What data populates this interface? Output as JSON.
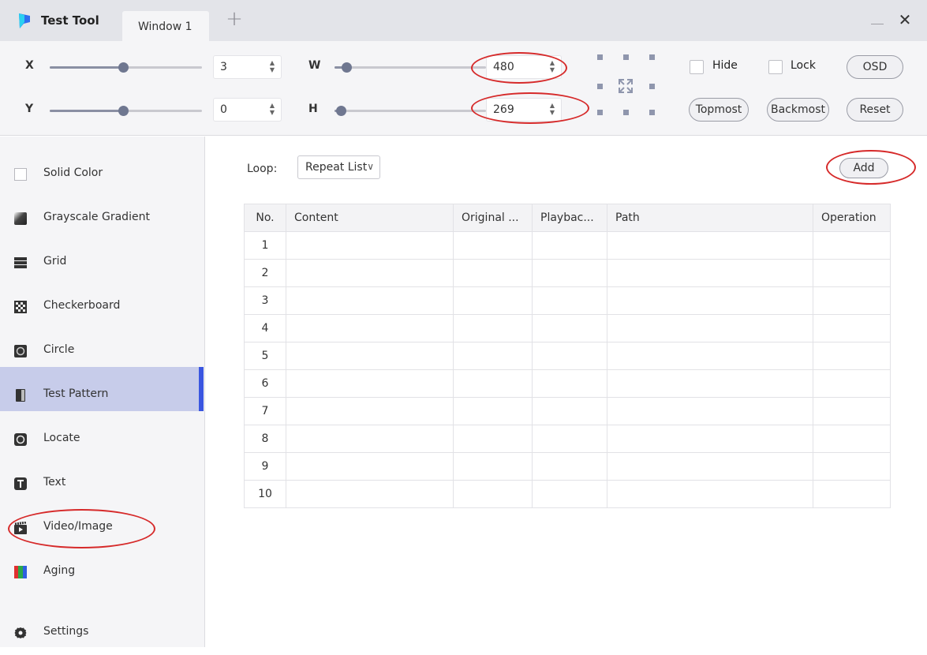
{
  "app": {
    "title": "Test Tool"
  },
  "tabs": [
    {
      "label": "Window 1"
    }
  ],
  "window_controls": {
    "minimize": "—",
    "close": "✕"
  },
  "toolbar": {
    "x": {
      "label": "X",
      "value": "3",
      "slider_fraction": 0.48
    },
    "y": {
      "label": "Y",
      "value": "0",
      "slider_fraction": 0.48
    },
    "w": {
      "label": "W",
      "value": "480",
      "slider_fraction": 0.08
    },
    "h": {
      "label": "H",
      "value": "269",
      "slider_fraction": 0.04
    },
    "hide": {
      "label": "Hide",
      "checked": false
    },
    "lock": {
      "label": "Lock",
      "checked": false
    },
    "osd_button": "OSD",
    "topmost_button": "Topmost",
    "backmost_button": "Backmost",
    "reset_button": "Reset"
  },
  "sidebar": {
    "items": [
      {
        "label": "Solid Color",
        "icon": "square-outline-icon"
      },
      {
        "label": "Grayscale Gradient",
        "icon": "gradient-icon"
      },
      {
        "label": "Grid",
        "icon": "grid-icon"
      },
      {
        "label": "Checkerboard",
        "icon": "checkerboard-icon"
      },
      {
        "label": "Circle",
        "icon": "circle-icon"
      },
      {
        "label": "Test Pattern",
        "icon": "test-pattern-icon"
      },
      {
        "label": "Locate",
        "icon": "locate-icon"
      },
      {
        "label": "Text",
        "icon": "text-icon"
      },
      {
        "label": "Video/Image",
        "icon": "video-icon",
        "active": true
      },
      {
        "label": "Aging",
        "icon": "aging-icon"
      }
    ],
    "settings": {
      "label": "Settings",
      "icon": "gear-icon"
    }
  },
  "main": {
    "loop": {
      "label": "Loop:",
      "value": "Repeat List",
      "chevron": "∨"
    },
    "add_button": "Add",
    "table": {
      "columns": [
        "No.",
        "Content",
        "Original ...",
        "Playbac...",
        "Path",
        "Operation"
      ],
      "rows": [
        "1",
        "2",
        "3",
        "4",
        "5",
        "6",
        "7",
        "8",
        "9",
        "10"
      ]
    }
  },
  "colors": {
    "accent": "#3a56e0",
    "active_bg": "#c7ccea",
    "highlight_ring": "#d62a2a"
  }
}
